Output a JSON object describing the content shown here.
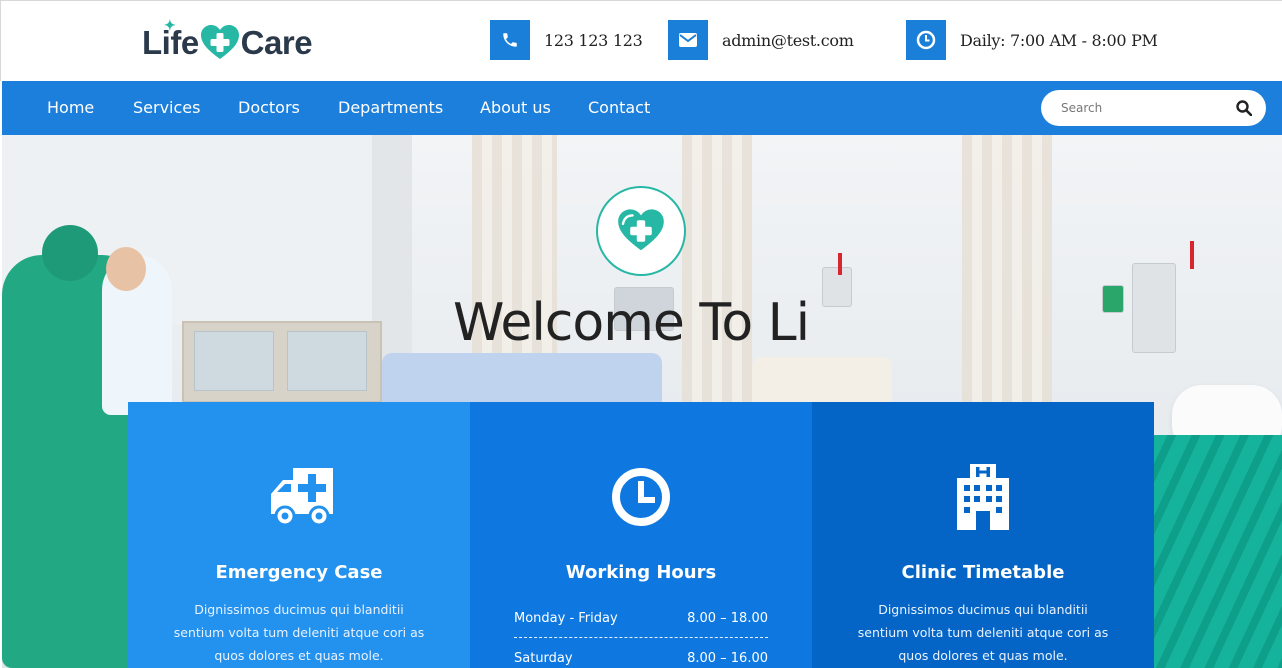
{
  "brand": {
    "logo_left": "Life",
    "logo_right": "Care"
  },
  "contacts": {
    "phone": "123 123 123",
    "email": "admin@test.com",
    "hours": "Daily: 7:00 AM - 8:00 PM"
  },
  "nav": {
    "items": [
      {
        "label": "Home"
      },
      {
        "label": "Services"
      },
      {
        "label": "Doctors"
      },
      {
        "label": "Departments"
      },
      {
        "label": "About us"
      },
      {
        "label": "Contact"
      }
    ]
  },
  "search": {
    "placeholder": "Search",
    "value": ""
  },
  "hero": {
    "title": "Welcome To Li"
  },
  "cards": [
    {
      "icon": "ambulance-icon",
      "title": "Emergency Case",
      "text": "Dignissimos ducimus qui blanditii sentium volta tum deleniti atque cori as quos dolores et quas mole."
    },
    {
      "icon": "clock-icon",
      "title": "Working Hours",
      "rows": [
        {
          "day": "Monday - Friday",
          "time": "8.00 – 18.00"
        },
        {
          "day": "Saturday",
          "time": "8.00 – 16.00"
        }
      ]
    },
    {
      "icon": "hospital-icon",
      "title": "Clinic Timetable",
      "text": "Dignissimos ducimus qui blanditii sentium volta tum deleniti atque cori as quos dolores et quas mole."
    }
  ],
  "colors": {
    "primary": "#1b7fdb",
    "teal": "#27b7a5",
    "card1": "#2391ee",
    "card2": "#0f78e0",
    "card3": "#0565c6"
  }
}
